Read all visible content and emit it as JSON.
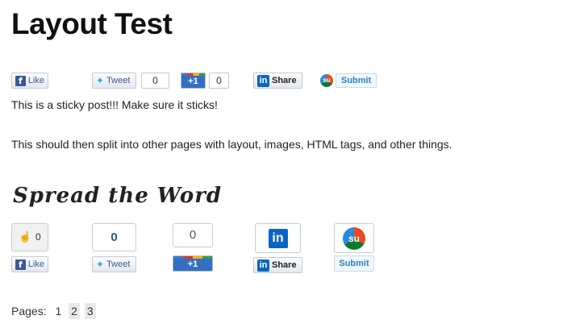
{
  "page": {
    "title": "Layout Test",
    "paragraphs": [
      "This is a sticky post!!! Make sure it sticks!",
      "This should then split into other pages with layout, images, HTML tags, and other things."
    ],
    "spread_heading": "Spread the Word"
  },
  "share_top": {
    "facebook_label": "Like",
    "twitter_label": "Tweet",
    "twitter_count": "0",
    "gplus_label": "+1",
    "gplus_count": "0",
    "linkedin_label": "Share",
    "stumble_label": "Submit"
  },
  "share_bottom": {
    "facebook_count": "0",
    "facebook_label": "Like",
    "twitter_count": "0",
    "twitter_label": "Tweet",
    "gplus_count": "0",
    "gplus_label": "+1",
    "linkedin_label": "Share",
    "stumble_label": "Submit"
  },
  "pagination": {
    "label": "Pages:",
    "pages": [
      "1",
      "2",
      "3"
    ]
  },
  "icons": {
    "facebook": "facebook-icon",
    "twitter": "twitter-icon",
    "linkedin": "linkedin-icon",
    "stumbleupon": "stumbleupon-icon",
    "thumbs_up": "thumbs-up-icon"
  },
  "colors": {
    "facebook": "#3b5998",
    "twitter": "#3aa7e0",
    "linkedin": "#0a66c2",
    "gplus": "#3470c2"
  }
}
